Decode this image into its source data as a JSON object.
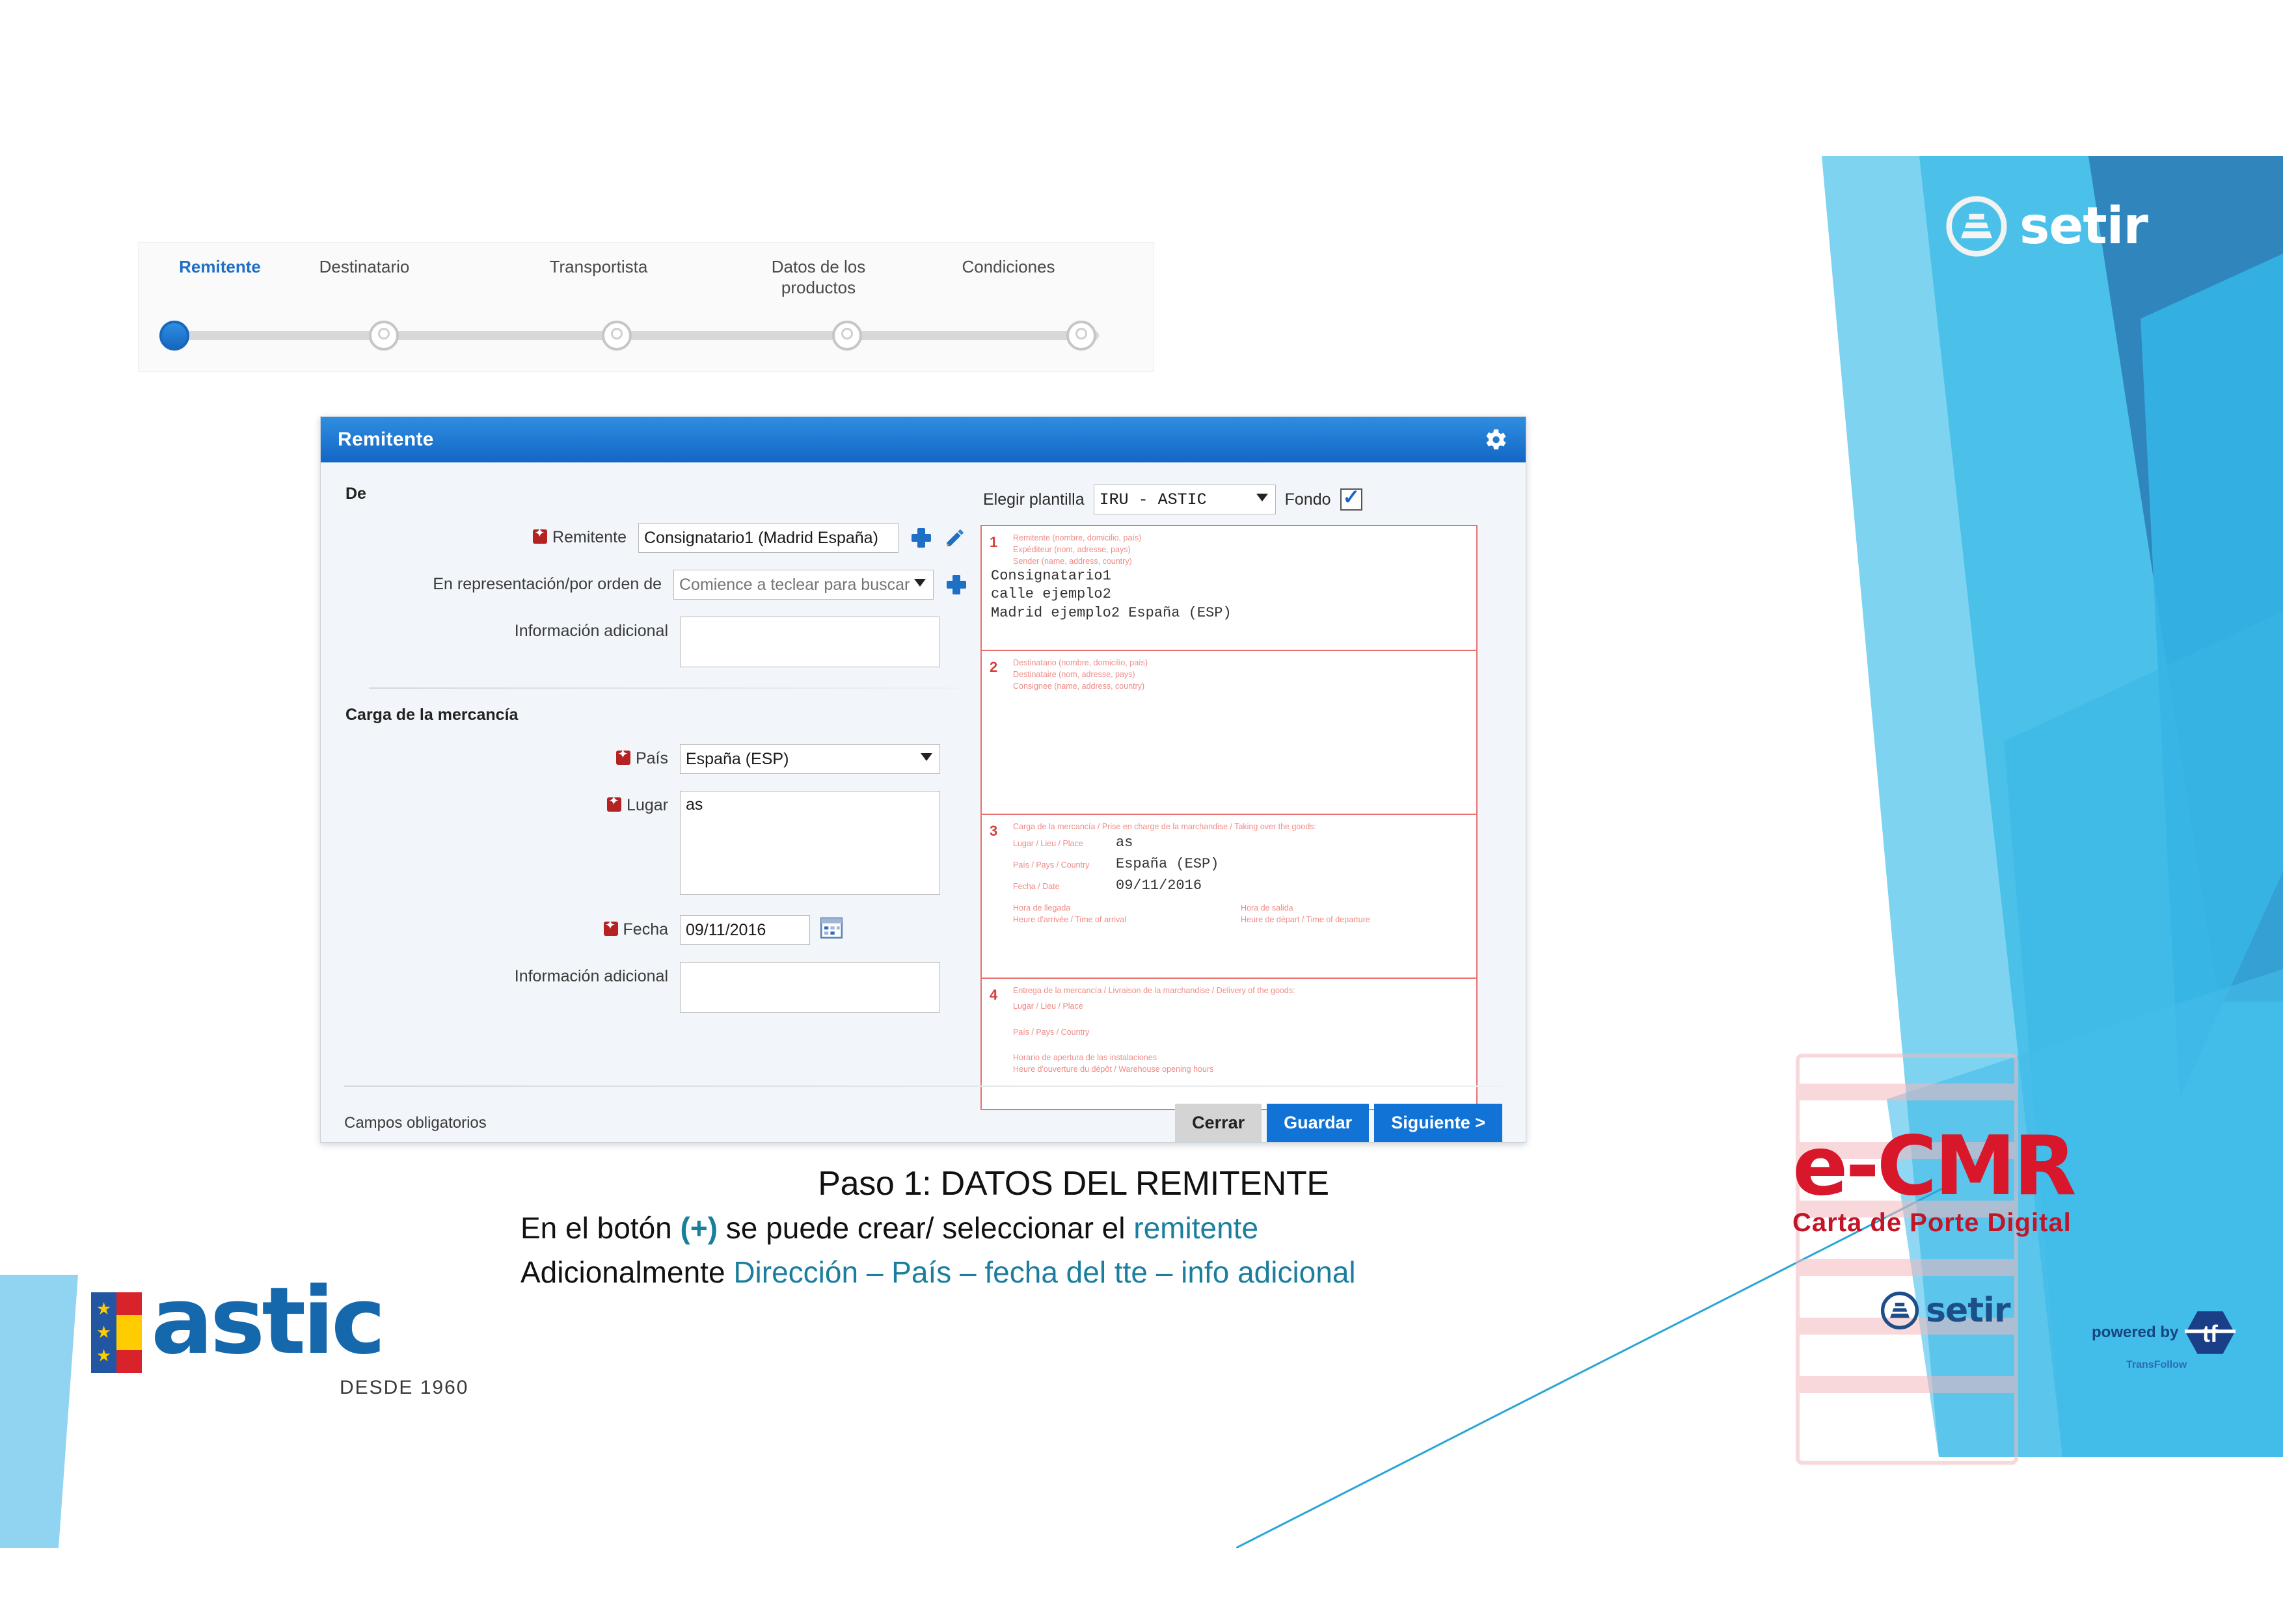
{
  "wizard": {
    "steps": [
      {
        "label": "Remitente",
        "state": "active"
      },
      {
        "label": "Destinatario",
        "state": "pending"
      },
      {
        "label": "Transportista",
        "state": "pending"
      },
      {
        "label": "Datos de los productos",
        "state": "pending"
      },
      {
        "label": "Condiciones",
        "state": "pending"
      }
    ]
  },
  "dialog": {
    "title": "Remitente",
    "gear_icon": "gear-icon",
    "section_de": "De",
    "section_carga": "Carga de la mercancía",
    "fields": {
      "remitente_label": "Remitente",
      "remitente_value": "Consignatario1 (Madrid España)",
      "representacion_label": "En representación/por orden de",
      "representacion_placeholder": "Comience a teclear para buscar",
      "info_adicional_label": "Información adicional",
      "info_adicional_value": "",
      "pais_label": "País",
      "pais_value": "España (ESP)",
      "lugar_label": "Lugar",
      "lugar_value": "as",
      "fecha_label": "Fecha",
      "fecha_value": "09/11/2016",
      "info_adicional2_label": "Información adicional",
      "info_adicional2_value": ""
    },
    "template": {
      "label": "Elegir plantilla",
      "value": "IRU - ASTIC",
      "fondo_label": "Fondo",
      "fondo_checked": true
    },
    "footer": {
      "required_note": "Campos obligatorios",
      "close_label": "Cerrar",
      "save_label": "Guardar",
      "next_label": "Siguiente >"
    }
  },
  "cmr_preview": {
    "box1": {
      "number": "1",
      "line_es": "Remitente (nombre, domicilio, país)",
      "line_fr": "Expéditeur (nom, adresse, pays)",
      "line_en": "Sender (name, address, country)",
      "value": "Consignatario1\ncalle ejemplo2\nMadrid ejemplo2 España (ESP)"
    },
    "box2": {
      "number": "2",
      "line_es": "Destinatario (nombre, domicilio, país)",
      "line_fr": "Destinataire (nom, adresse, pays)",
      "line_en": "Consignee (name, address, country)",
      "value": ""
    },
    "box3": {
      "number": "3",
      "heading": "Carga de la mercancía / Prise en charge de la marchandise / Taking over the goods:",
      "lugar_key": "Lugar / Lieu / Place",
      "lugar_value": "as",
      "pais_key": "País / Pays / Country",
      "pais_value": "España (ESP)",
      "fecha_key": "Fecha / Date",
      "fecha_value": "09/11/2016",
      "llegada_es": "Hora de llegada",
      "llegada_fr": "Heure d'arrivée / Time of arrival",
      "salida_es": "Hora de salida",
      "salida_fr": "Heure de départ / Time of departure"
    },
    "box4": {
      "number": "4",
      "heading": "Entrega de la mercancía / Livraison de la marchandise / Delivery of the goods:",
      "lugar_key": "Lugar / Lieu / Place",
      "pais_key": "País / Pays / Country",
      "horario_es": "Horario de apertura de las instalaciones",
      "horario_fr": "Heure d'ouverture du dépôt / Warehouse opening hours"
    }
  },
  "caption": {
    "title": "Paso 1: DATOS DEL REMITENTE",
    "line2_a": "En el botón ",
    "line2_plus": "(+)",
    "line2_b": " se puede crear/ seleccionar el ",
    "line2_c": "remitente",
    "line3_a": "Adicionalmente ",
    "line3_b": "Dirección – País – fecha del tte – info adicional"
  },
  "logos": {
    "astic_word": "astic",
    "astic_tagline": "DESDE 1960",
    "setir_word": "setir",
    "ecmr_main": "e-CMR",
    "ecmr_sub": "Carta de Porte Digital",
    "powered_by": "powered by",
    "tf_mark": "tf",
    "tf_name": "TransFollow"
  },
  "colors": {
    "brand_blue": "#1173d6",
    "header_blue": "#1266c4",
    "astic_blue": "#1668ad",
    "cmr_red": "#d8172b",
    "teal": "#1b7e9e",
    "cmr_outline": "#e8726e"
  }
}
